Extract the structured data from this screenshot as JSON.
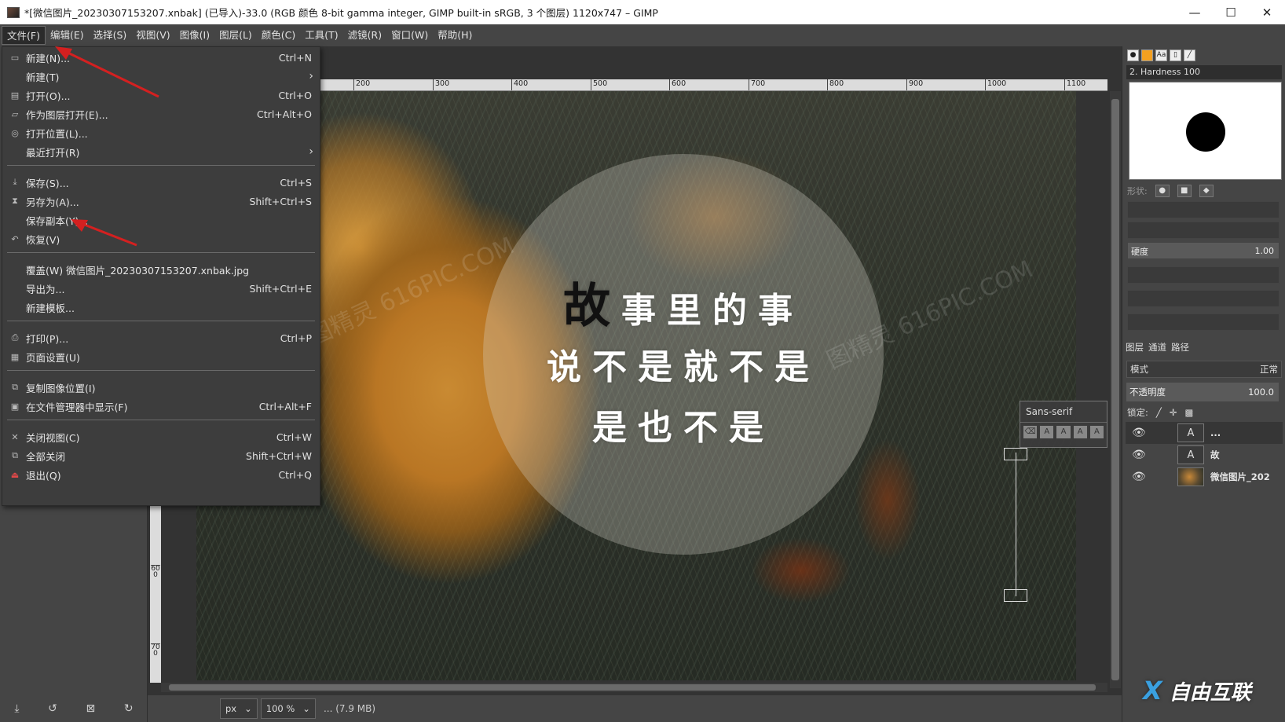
{
  "window": {
    "title": "*[微信图片_20230307153207.xnbak] (已导入)-33.0 (RGB 颜色 8-bit gamma integer, GIMP built-in sRGB, 3 个图层) 1120x747 – GIMP",
    "minimize": "—",
    "maximize": "☐",
    "close": "✕"
  },
  "menubar": [
    "文件(F)",
    "编辑(E)",
    "选择(S)",
    "视图(V)",
    "图像(I)",
    "图层(L)",
    "颜色(C)",
    "工具(T)",
    "滤镜(R)",
    "窗口(W)",
    "帮助(H)"
  ],
  "file_menu": [
    {
      "label": "新建(N)...",
      "shortcut": "Ctrl+N",
      "icon": "new-icon"
    },
    {
      "label": "新建(T)",
      "shortcut": "",
      "icon": "",
      "submenu": true
    },
    {
      "label": "打开(O)...",
      "shortcut": "Ctrl+O",
      "icon": "open-icon"
    },
    {
      "label": "作为图层打开(E)...",
      "shortcut": "Ctrl+Alt+O",
      "icon": "open-as-layer-icon"
    },
    {
      "label": "打开位置(L)...",
      "shortcut": "",
      "icon": "open-location-icon"
    },
    {
      "label": "最近打开(R)",
      "shortcut": "",
      "icon": "",
      "submenu": true
    },
    {
      "label": "保存(S)...",
      "shortcut": "Ctrl+S",
      "icon": "save-icon"
    },
    {
      "label": "另存为(A)...",
      "shortcut": "Shift+Ctrl+S",
      "icon": "save-as-icon"
    },
    {
      "label": "保存副本(Y)...",
      "shortcut": "",
      "icon": ""
    },
    {
      "label": "恢复(V)",
      "shortcut": "",
      "icon": "revert-icon"
    },
    {
      "label": "覆盖(W) 微信图片_20230307153207.xnbak.jpg",
      "shortcut": "",
      "icon": ""
    },
    {
      "label": "导出为...",
      "shortcut": "Shift+Ctrl+E",
      "icon": ""
    },
    {
      "label": "新建模板...",
      "shortcut": "",
      "icon": ""
    },
    {
      "label": "打印(P)...",
      "shortcut": "Ctrl+P",
      "icon": "print-icon"
    },
    {
      "label": "页面设置(U)",
      "shortcut": "",
      "icon": "page-setup-icon"
    },
    {
      "label": "复制图像位置(I)",
      "shortcut": "",
      "icon": "copy-location-icon"
    },
    {
      "label": "在文件管理器中显示(F)",
      "shortcut": "Ctrl+Alt+F",
      "icon": "file-manager-icon"
    },
    {
      "label": "关闭视图(C)",
      "shortcut": "Ctrl+W",
      "icon": "close-view-icon"
    },
    {
      "label": "全部关闭",
      "shortcut": "Shift+Ctrl+W",
      "icon": "close-all-icon"
    },
    {
      "label": "退出(Q)",
      "shortcut": "Ctrl+Q",
      "icon": "quit-icon"
    }
  ],
  "ruler": {
    "h_ticks": [
      "200",
      "300",
      "400",
      "500",
      "600",
      "700",
      "800",
      "900",
      "1000",
      "1100"
    ],
    "v_ticks": [
      "600",
      "700"
    ]
  },
  "canvas": {
    "watermark": "图精灵 616PIC.COM",
    "poem": {
      "line1_first": "故",
      "line1_rest": "事里的事",
      "line2": "说不是就不是",
      "line3": "是也不是"
    }
  },
  "text_tool": {
    "font": "Sans-serif"
  },
  "status": {
    "unit": "px",
    "zoom": "100 %",
    "info": "... (7.9 MB)"
  },
  "brushes": {
    "name": "2. Hardness 100",
    "shape_label": "形状:",
    "hardness_label": "硬度",
    "hardness_value": "1.00"
  },
  "layers_panel": {
    "tabs": [
      "图层",
      "通道",
      "路径"
    ],
    "mode_label": "模式",
    "mode_value": "正常",
    "opacity_label": "不透明度",
    "opacity_value": "100.0",
    "lock_label": "锁定:",
    "layers": [
      {
        "name": "...",
        "type": "text"
      },
      {
        "name": "故",
        "type": "text"
      },
      {
        "name": "微信图片_202",
        "type": "image"
      }
    ]
  },
  "logo": {
    "x": "X",
    "text": "自由互联"
  },
  "colors": {
    "menubar": "#454545",
    "accent_arrow": "#d42020"
  }
}
